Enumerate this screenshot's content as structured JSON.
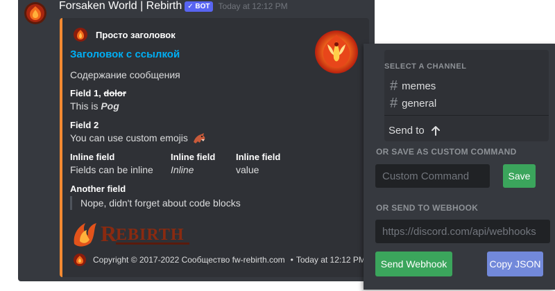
{
  "message": {
    "author": "Forsaken World | Rebirth",
    "bot_tag": "✓ BOT",
    "timestamp": "Today at 12:12 PM"
  },
  "embed": {
    "accent_color": "#f48a32",
    "author_name": "Просто заголовок",
    "title": "Заголовок с ссылкой",
    "description": "Содержание сообщения",
    "fields": [
      {
        "name_plain": "Field 1, ",
        "name_strike": "dolor",
        "value_plain": "This is ",
        "value_italic": "Pog"
      },
      {
        "name": "Field 2",
        "value": "You can use custom emojis"
      },
      {
        "name": "Inline field",
        "value": "Fields can be inline"
      },
      {
        "name": "Inline field",
        "value": "Inline"
      },
      {
        "name": "Inline field",
        "value": "value"
      },
      {
        "name": "Another field",
        "value": "Nope, didn't forget about code blocks"
      }
    ],
    "footer": {
      "text": "Copyright © 2017-2022 Сообщество fw-rebirth.com",
      "separator": "•",
      "time": "Today at 12:12 PM"
    }
  },
  "panel": {
    "channel_header": "SELECT A CHANNEL",
    "channels": [
      "memes",
      "general"
    ],
    "send_to": "Send to",
    "custom_command_label": "OR SAVE AS CUSTOM COMMAND",
    "custom_command_placeholder": "Custom Command",
    "save_label": "Save",
    "webhook_label": "OR SEND TO WEBHOOK",
    "webhook_placeholder": "https://discord.com/api/webhooks",
    "send_webhook_label": "Send Webhook",
    "copy_json_label": "Copy JSON"
  },
  "colors": {
    "background": "#36393f",
    "embed_bg": "#2f3136",
    "link": "#00aff4",
    "green": "#3ba55c",
    "blurple": "#7289da"
  },
  "icons": [
    "rebirth-phoenix-avatar",
    "rebirth-phoenix-logo",
    "dragon-emoji",
    "arrow-up-icon",
    "hash-icon"
  ]
}
